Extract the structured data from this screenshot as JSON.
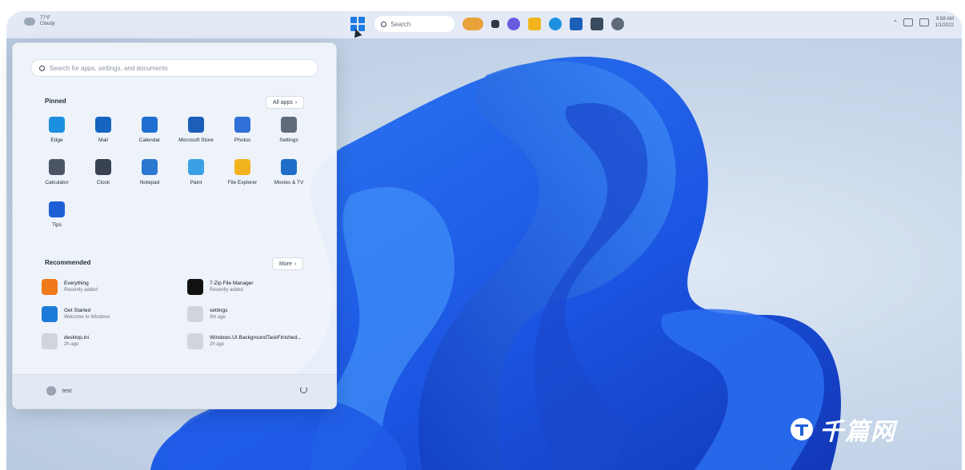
{
  "taskbar": {
    "weather": {
      "temp": "77°F",
      "condition": "Cloudy"
    },
    "search_label": "Search",
    "tray": {
      "time": "9:58 AM",
      "date": "1/1/2022"
    }
  },
  "start_menu": {
    "search_placeholder": "Search for apps, settings, and documents",
    "pinned_title": "Pinned",
    "all_apps_label": "All apps",
    "pinned": [
      {
        "label": "Edge",
        "icon": "edge-icon",
        "color": "#1d8fe1"
      },
      {
        "label": "Mail",
        "icon": "mail-icon",
        "color": "#1565c0"
      },
      {
        "label": "Calendar",
        "icon": "calendar-icon",
        "color": "#1e6fcf"
      },
      {
        "label": "Microsoft Store",
        "icon": "store-icon",
        "color": "#1b5fb8"
      },
      {
        "label": "Photos",
        "icon": "photos-icon",
        "color": "#2f6fd6"
      },
      {
        "label": "Settings",
        "icon": "settings-icon",
        "color": "#5f6b7a"
      },
      {
        "label": "Calculator",
        "icon": "calculator-icon",
        "color": "#4b5563"
      },
      {
        "label": "Clock",
        "icon": "clock-icon",
        "color": "#374151"
      },
      {
        "label": "Notepad",
        "icon": "notepad-icon",
        "color": "#2b78d0"
      },
      {
        "label": "Paint",
        "icon": "paint-icon",
        "color": "#3aa0e6"
      },
      {
        "label": "File Explorer",
        "icon": "folder-icon",
        "color": "#f2b41d"
      },
      {
        "label": "Movies & TV",
        "icon": "movies-icon",
        "color": "#1f6fc9"
      },
      {
        "label": "Tips",
        "icon": "tips-icon",
        "color": "#1f5fd6"
      }
    ],
    "recommended_title": "Recommended",
    "more_label": "More",
    "recommended": [
      {
        "name": "Everything",
        "sub": "Recently added",
        "icon": "everything-icon",
        "color": "#f07a1a"
      },
      {
        "name": "7-Zip File Manager",
        "sub": "Recently added",
        "icon": "7zip-icon",
        "color": "#111111"
      },
      {
        "name": "Get Started",
        "sub": "Welcome to Windows",
        "icon": "get-started-icon",
        "color": "#1c7bd8"
      },
      {
        "name": "settings",
        "sub": "3m ago",
        "icon": "document-icon",
        "color": "#d1d5db"
      },
      {
        "name": "desktop.ini",
        "sub": "2h ago",
        "icon": "document-icon",
        "color": "#d1d5db"
      },
      {
        "name": "Windows.UI.BackgroundTaskFinished...",
        "sub": "2h ago",
        "icon": "document-icon",
        "color": "#d1d5db"
      }
    ],
    "user_name": "test"
  },
  "watermark": {
    "text": "千篇网"
  },
  "colors": {
    "accent": "#1f7ae0",
    "bloom": "#1a55e0"
  }
}
